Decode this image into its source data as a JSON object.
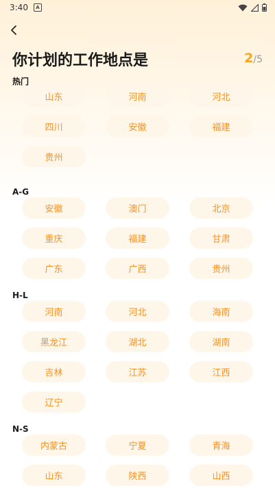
{
  "status": {
    "time": "3:40",
    "notif_glyph": "A"
  },
  "header": {
    "title": "你计划的工作地点是",
    "step_current": "2",
    "step_sep_total": "/5"
  },
  "sections": [
    {
      "label": "热门",
      "items": [
        "山东",
        "河南",
        "河北",
        "四川",
        "安徽",
        "福建",
        "贵州"
      ]
    },
    {
      "label": "A-G",
      "items": [
        "安徽",
        "澳门",
        "北京",
        "重庆",
        "福建",
        "甘肃",
        "广东",
        "广西",
        "贵州"
      ]
    },
    {
      "label": "H-L",
      "items": [
        "河南",
        "河北",
        "海南",
        "黑龙江",
        "湖北",
        "湖南",
        "吉林",
        "江苏",
        "江西",
        "辽宁"
      ]
    },
    {
      "label": "N-S",
      "items": [
        "内蒙古",
        "宁夏",
        "青海",
        "山东",
        "陕西",
        "山西"
      ]
    }
  ],
  "colors": {
    "accent": "#F59223",
    "chip_bg": "#FFF6EA"
  }
}
